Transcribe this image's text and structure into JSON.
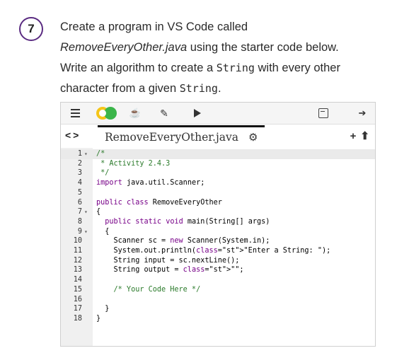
{
  "step": {
    "number": "7"
  },
  "instructions": {
    "line1": "Create a program in VS Code called",
    "line2_file": "RemoveEveryOther.java",
    "line2_rest": " using the starter code below.",
    "line3_pre": "Write an algorithm to create a ",
    "line3_code": "String",
    "line3_post": " with every other",
    "line4_pre": "character from a given ",
    "line4_code": "String",
    "line4_post": "."
  },
  "toolbar": {
    "menu_icon": "hamburger-icon",
    "logo_icon": "repl-logo-icon",
    "java_icon": "java-icon",
    "edit_icon": "pencil-icon",
    "run_icon": "play-icon",
    "save_icon": "save-icon",
    "signin_icon": "sign-in-icon"
  },
  "tabs": {
    "nav_label": "<>",
    "file_name": "RemoveEveryOther.java",
    "add_label": "+",
    "upload_label": "⬆"
  },
  "code_lines": [
    {
      "n": "1",
      "fold": "▾",
      "text": "/*"
    },
    {
      "n": "2",
      "fold": "",
      "text": " * Activity 2.4.3"
    },
    {
      "n": "3",
      "fold": "",
      "text": " */"
    },
    {
      "n": "4",
      "fold": "",
      "text": "import java.util.Scanner;"
    },
    {
      "n": "5",
      "fold": "",
      "text": ""
    },
    {
      "n": "6",
      "fold": "",
      "text": "public class RemoveEveryOther"
    },
    {
      "n": "7",
      "fold": "▾",
      "text": "{"
    },
    {
      "n": "8",
      "fold": "",
      "text": "  public static void main(String[] args)"
    },
    {
      "n": "9",
      "fold": "▾",
      "text": "  {"
    },
    {
      "n": "10",
      "fold": "",
      "text": "    Scanner sc = new Scanner(System.in);"
    },
    {
      "n": "11",
      "fold": "",
      "text": "    System.out.println(\"Enter a String: \");"
    },
    {
      "n": "12",
      "fold": "",
      "text": "    String input = sc.nextLine();"
    },
    {
      "n": "13",
      "fold": "",
      "text": "    String output = \"\";"
    },
    {
      "n": "14",
      "fold": "",
      "text": ""
    },
    {
      "n": "15",
      "fold": "",
      "text": "    /* Your Code Here */"
    },
    {
      "n": "16",
      "fold": "",
      "text": ""
    },
    {
      "n": "17",
      "fold": "",
      "text": "  }"
    },
    {
      "n": "18",
      "fold": "",
      "text": "}"
    }
  ]
}
